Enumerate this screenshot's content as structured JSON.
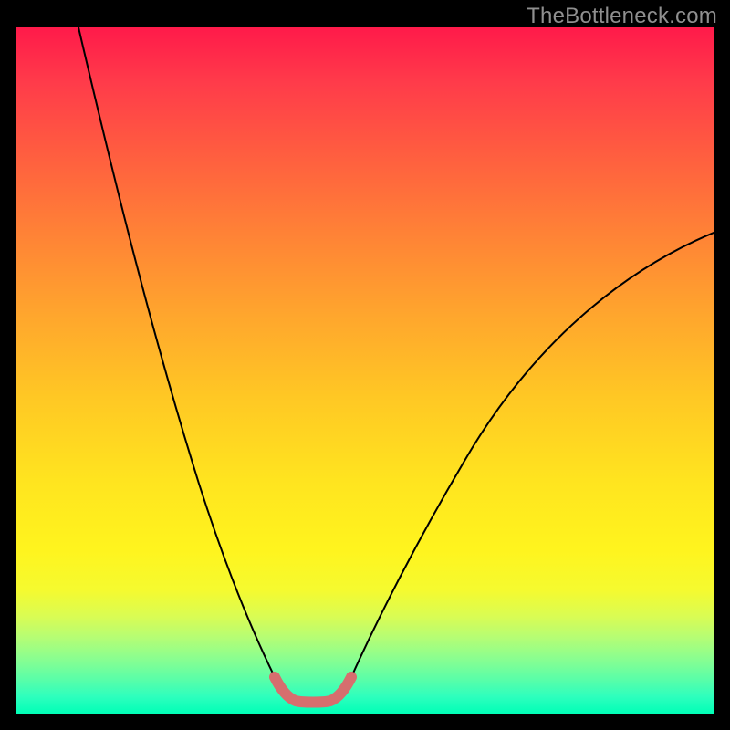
{
  "credit_text": "TheBottleneck.com",
  "colors": {
    "background": "#000000",
    "curve": "#000000",
    "highlight": "#d66e6e",
    "gradient_top": "#ff1a4a",
    "gradient_bottom": "#00ffb7"
  },
  "chart_data": {
    "type": "line",
    "title": "",
    "xlabel": "",
    "ylabel": "",
    "xlim": [
      0,
      100
    ],
    "ylim": [
      0,
      100
    ],
    "series": [
      {
        "name": "left-branch",
        "x": [
          9,
          12,
          15,
          18,
          21,
          24,
          27,
          30,
          33,
          35,
          37
        ],
        "y": [
          100,
          84,
          70,
          57,
          45,
          35,
          26,
          18,
          11,
          7,
          4
        ]
      },
      {
        "name": "valley-highlight",
        "x": [
          37,
          38,
          39,
          40,
          41,
          42,
          43,
          44,
          45,
          46,
          47,
          48
        ],
        "y": [
          4,
          2.6,
          1.9,
          1.6,
          1.5,
          1.5,
          1.5,
          1.6,
          1.9,
          2.6,
          3.5,
          4.6
        ]
      },
      {
        "name": "right-branch",
        "x": [
          48,
          52,
          56,
          60,
          65,
          70,
          75,
          80,
          85,
          90,
          95,
          100
        ],
        "y": [
          4.6,
          9,
          14,
          20,
          27,
          34,
          41,
          48,
          54,
          60,
          65,
          70
        ]
      }
    ],
    "legend": false,
    "grid": false
  }
}
